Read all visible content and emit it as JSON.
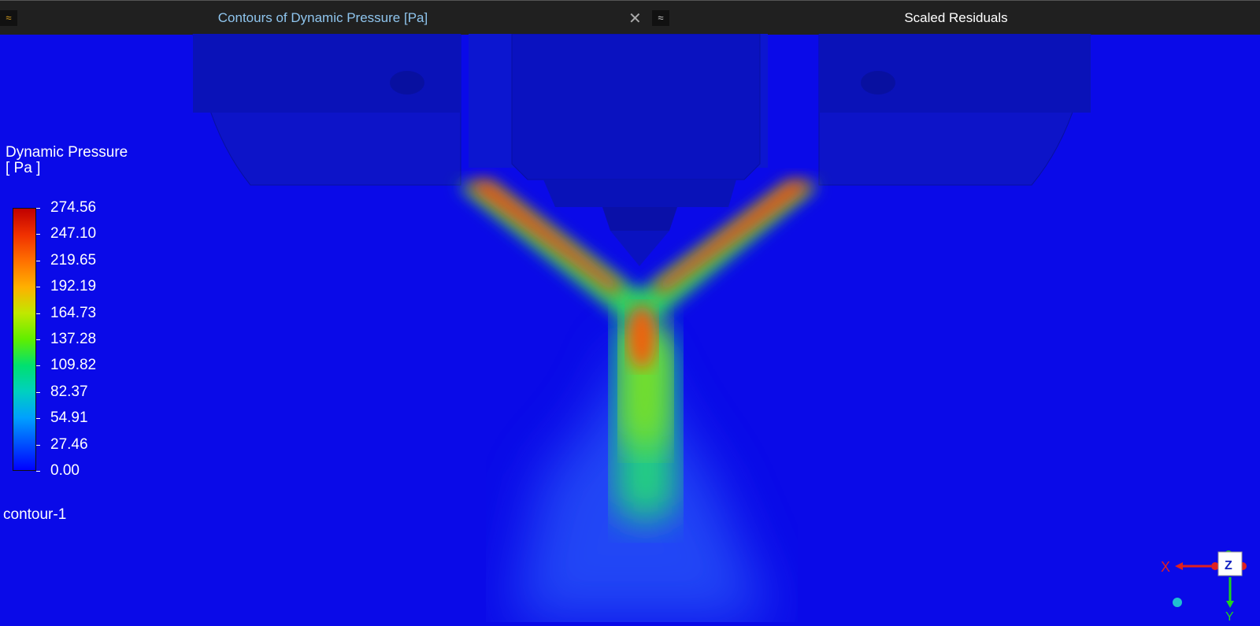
{
  "tabs": [
    {
      "label": "Contours of Dynamic Pressure [Pa]",
      "active": true
    },
    {
      "label": "Scaled Residuals",
      "active": false
    }
  ],
  "legend": {
    "title": "Dynamic Pressure",
    "unit": "[ Pa ]",
    "ticks": [
      "274.56",
      "247.10",
      "219.65",
      "192.19",
      "164.73",
      "137.28",
      "109.82",
      "82.37",
      "54.91",
      "27.46",
      "0.00"
    ],
    "min": 0,
    "max": 274.56
  },
  "contour_name": "contour-1",
  "axes": {
    "x": "X",
    "y": "Y"
  },
  "colors": {
    "background": "#0a0ae8",
    "tab_active_text": "#8fc5ee"
  }
}
